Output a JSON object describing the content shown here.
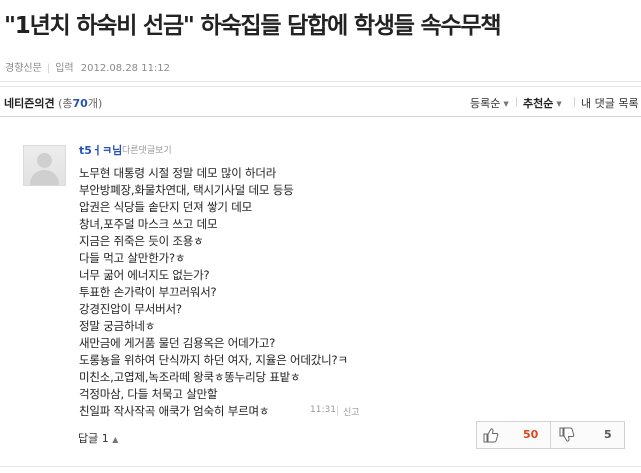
{
  "article": {
    "headline": "\"1년치 하숙비 선금\" 하숙집들 담합에 학생들 속수무책",
    "source": "경향신문",
    "input_label": "입력",
    "date": "2012.08.28 11:12"
  },
  "comments_header": {
    "title": "네티즌의견",
    "paren_open": "(총",
    "count": "70",
    "paren_close": "개)",
    "sort_options": [
      "등록순",
      "추천순"
    ],
    "my_comments": "내 댓글 목록"
  },
  "comment": {
    "author": "t5ㅓㅋ님",
    "reply_view": "다른댓글보기",
    "lines": [
      "노무현 대통령 시절 정말 데모 많이 하더라",
      "부안방폐장,화물차연대, 택시기사덜 데모 등등",
      "압권은 식당들 솥단지 던져 쌓기 데모",
      "창녀,포주덜 마스크 쓰고 데모",
      "지금은 쥐죽은 듯이 조용ㅎ",
      "다들 먹고 살만한가?ㅎ",
      "너무 굶어 에너지도 없는가?",
      "투표한 손가락이 부끄러워서?",
      "강경진압이 무서버서?",
      "정말 궁금하네ㅎ",
      "새만금에 게거품 물던 김용옥은 어데가고?",
      "도롱뇽을 위하여 단식까지 하던 여자, 지율은 어데갔니?ㅋ",
      "미친소,고엽제,녹조라떼 왕쿡ㅎ똥누리당 표밭ㅎ",
      "걱정마삼, 다들 처묵고 살만할",
      "친일파 작사작곡 애쿡가 엄숙히 부르며ㅎ"
    ],
    "time": "11:31",
    "report": "신고",
    "reply_label": "답글",
    "reply_count": "1",
    "likes": "50",
    "dislikes": "5"
  },
  "icons": {
    "like": "thumbs-up",
    "dislike": "thumbs-down",
    "sort_caret": "triangle-down",
    "reply_caret": "triangle-up"
  },
  "colors": {
    "link_blue": "#2553b5",
    "like_red": "#d9471c"
  }
}
